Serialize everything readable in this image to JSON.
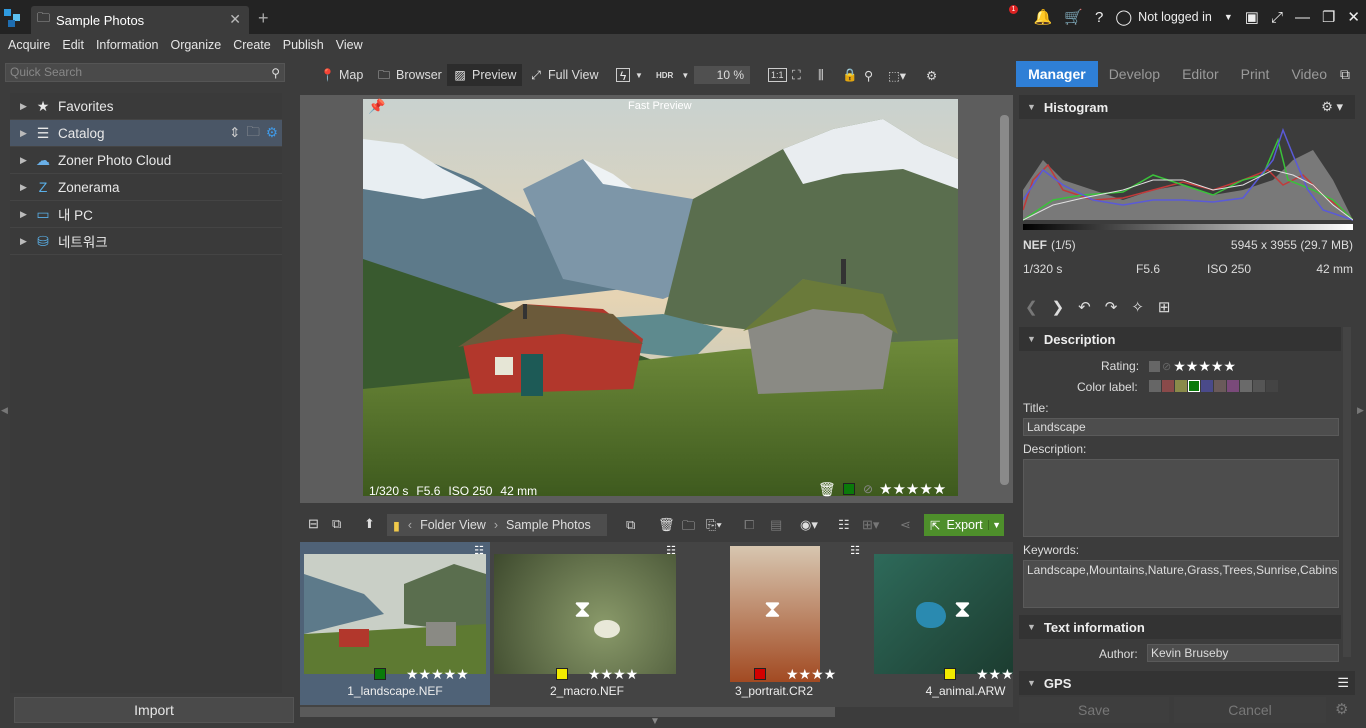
{
  "tab": {
    "title": "Sample Photos"
  },
  "topbar": {
    "notif_count": "1",
    "login": "Not logged in"
  },
  "menu": [
    "Acquire",
    "Edit",
    "Information",
    "Organize",
    "Create",
    "Publish",
    "View"
  ],
  "search": {
    "placeholder": "Quick Search"
  },
  "toolbar": {
    "map": "Map",
    "browser": "Browser",
    "preview": "Preview",
    "fullview": "Full View",
    "hdr": "HDR",
    "zoom": "10 %",
    "ratio": "1:1"
  },
  "modes": [
    "Manager",
    "Develop",
    "Editor",
    "Print",
    "Video"
  ],
  "nav": [
    "Favorites",
    "Catalog",
    "Zoner Photo Cloud",
    "Zonerama",
    "내 PC",
    "네트워크"
  ],
  "import_label": "Import",
  "preview": {
    "label": "Fast Preview",
    "shutter": "1/320 s",
    "aperture": "F5.6",
    "iso": "ISO 250",
    "focal": "42 mm"
  },
  "filmbar": {
    "folder_view": "Folder View",
    "folder": "Sample Photos",
    "export": "Export"
  },
  "thumbs": [
    {
      "name": "1_landscape.NEF",
      "label_color": "#0a7a0a",
      "stars": 5
    },
    {
      "name": "2_macro.NEF",
      "label_color": "#f2ea00",
      "stars": 4
    },
    {
      "name": "3_portrait.CR2",
      "label_color": "#d40000",
      "stars": 4
    },
    {
      "name": "4_animal.ARW",
      "label_color": "#f2ea00",
      "stars": 3
    }
  ],
  "histogram": {
    "title": "Histogram",
    "format": "NEF",
    "index": "(1/5)",
    "dimensions": "5945 x 3955 (29.7 MB)",
    "shutter": "1/320 s",
    "aperture": "F5.6",
    "iso": "ISO 250",
    "focal": "42 mm"
  },
  "description": {
    "section": "Description",
    "rating_label": "Rating:",
    "color_label": "Color label:",
    "title_label": "Title:",
    "title_value": "Landscape",
    "desc_label": "Description:",
    "keywords_label": "Keywords:",
    "keywords_value": "Landscape,Mountains,Nature,Grass,Trees,Sunrise,Cabins"
  },
  "textinfo": {
    "section": "Text information",
    "author_label": "Author:",
    "author_value": "Kevin Bruseby"
  },
  "gps": {
    "section": "GPS"
  },
  "actions": {
    "save": "Save",
    "cancel": "Cancel"
  },
  "colors": {
    "accent": "#2f7fd6",
    "export_green": "#4e8f2b"
  }
}
